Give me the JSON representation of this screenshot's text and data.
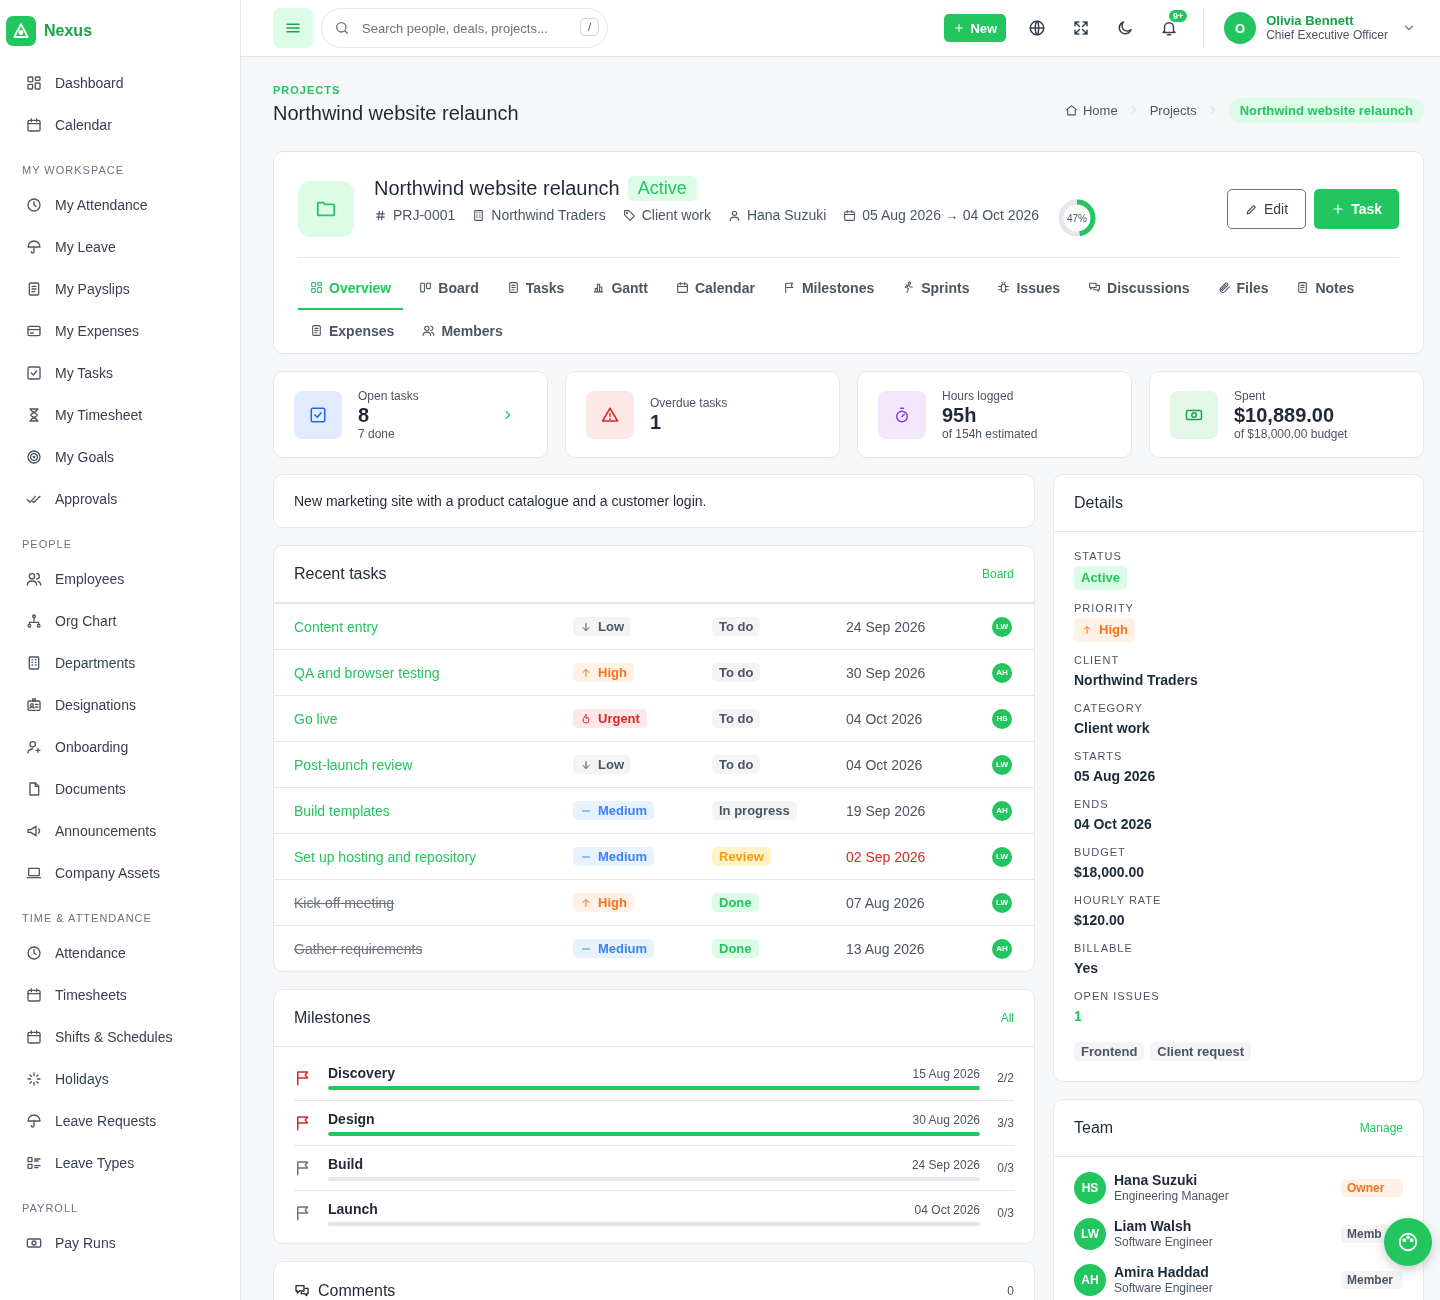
{
  "app": {
    "name": "Nexus"
  },
  "sidebar": {
    "groups": [
      {
        "items": [
          "Dashboard",
          "Calendar"
        ]
      },
      {
        "title": "MY WORKSPACE",
        "items": [
          "My Attendance",
          "My Leave",
          "My Payslips",
          "My Expenses",
          "My Tasks",
          "My Timesheet",
          "My Goals",
          "Approvals"
        ]
      },
      {
        "title": "PEOPLE",
        "items": [
          "Employees",
          "Org Chart",
          "Departments",
          "Designations",
          "Onboarding",
          "Documents",
          "Announcements",
          "Company Assets"
        ]
      },
      {
        "title": "TIME & ATTENDANCE",
        "items": [
          "Attendance",
          "Timesheets",
          "Shifts & Schedules",
          "Holidays",
          "Leave Requests",
          "Leave Types"
        ]
      },
      {
        "title": "PAYROLL",
        "items": [
          "Pay Runs"
        ]
      }
    ]
  },
  "topbar": {
    "search": {
      "placeholder": "Search people, deals, projects...",
      "shortcut": "/"
    },
    "new_button": "New",
    "notification_count": "9+",
    "user": {
      "initial": "O",
      "name": "Olivia Bennett",
      "role": "Chief Executive Officer"
    }
  },
  "page": {
    "section": "PROJECTS",
    "title": "Northwind website relaunch",
    "breadcrumbs": [
      {
        "label": "Home",
        "selected": false
      },
      {
        "label": "Projects",
        "selected": false
      },
      {
        "label": "Northwind website relaunch",
        "selected": true
      }
    ]
  },
  "project": {
    "title": "Northwind website relaunch",
    "status": "Active",
    "meta": [
      {
        "kind": "id",
        "text": "PRJ-0001"
      },
      {
        "kind": "client",
        "text": "Northwind Traders"
      },
      {
        "kind": "category",
        "text": "Client work"
      },
      {
        "kind": "owner",
        "text": "Hana Suzuki"
      },
      {
        "kind": "dates",
        "text": "05 Aug 2026 → 04 Oct 2026"
      }
    ],
    "progress": {
      "level": 0.47,
      "label": "47%"
    },
    "edit_button": "Edit",
    "task_button": "Task",
    "tabs": [
      {
        "label": "Overview",
        "selected": true
      },
      {
        "label": "Board",
        "selected": false
      },
      {
        "label": "Tasks",
        "selected": false
      },
      {
        "label": "Gantt",
        "selected": false
      },
      {
        "label": "Calendar",
        "selected": false
      },
      {
        "label": "Milestones",
        "selected": false
      },
      {
        "label": "Sprints",
        "selected": false
      },
      {
        "label": "Issues",
        "selected": false
      },
      {
        "label": "Discussions",
        "selected": false
      },
      {
        "label": "Files",
        "selected": false
      },
      {
        "label": "Notes",
        "selected": false
      },
      {
        "label": "Expenses",
        "selected": false
      },
      {
        "label": "Members",
        "selected": false
      }
    ]
  },
  "stats": [
    {
      "kind": "tasks",
      "label": "Open tasks",
      "value": "8",
      "sub": "7 done",
      "arrow": true
    },
    {
      "kind": "overdue",
      "label": "Overdue tasks",
      "value": "1",
      "arrow": false
    },
    {
      "kind": "hours",
      "label": "Hours logged",
      "value": "95h",
      "sub": "of 154h estimated",
      "arrow": false
    },
    {
      "kind": "spent",
      "label": "Spent",
      "value": "$10,889.00",
      "sub": "of $18,000.00 budget",
      "arrow": false
    }
  ],
  "description": "New marketing site with a product catalogue and a customer login.",
  "recent_tasks": {
    "title": "Recent tasks",
    "link": "Board",
    "rows": [
      {
        "name": "Content entry",
        "done": false,
        "priority": {
          "kind": "low",
          "label": "Low"
        },
        "status": {
          "kind": "todo",
          "label": "To do"
        },
        "due": "24 Sep 2026",
        "overdue": false,
        "assignee": "LW"
      },
      {
        "name": "QA and browser testing",
        "done": false,
        "priority": {
          "kind": "high",
          "label": "High"
        },
        "status": {
          "kind": "todo",
          "label": "To do"
        },
        "due": "30 Sep 2026",
        "overdue": false,
        "assignee": "AH"
      },
      {
        "name": "Go live",
        "done": false,
        "priority": {
          "kind": "urgent",
          "label": "Urgent"
        },
        "status": {
          "kind": "todo",
          "label": "To do"
        },
        "due": "04 Oct 2026",
        "overdue": false,
        "assignee": "HS"
      },
      {
        "name": "Post-launch review",
        "done": false,
        "priority": {
          "kind": "low",
          "label": "Low"
        },
        "status": {
          "kind": "todo",
          "label": "To do"
        },
        "due": "04 Oct 2026",
        "overdue": false,
        "assignee": "LW"
      },
      {
        "name": "Build templates",
        "done": false,
        "priority": {
          "kind": "medium",
          "label": "Medium"
        },
        "status": {
          "kind": "progress",
          "label": "In progress"
        },
        "due": "19 Sep 2026",
        "overdue": false,
        "assignee": "AH"
      },
      {
        "name": "Set up hosting and repository",
        "done": false,
        "priority": {
          "kind": "medium",
          "label": "Medium"
        },
        "status": {
          "kind": "review",
          "label": "Review"
        },
        "due": "02 Sep 2026",
        "overdue": true,
        "assignee": "LW"
      },
      {
        "name": "Kick-off meeting",
        "done": true,
        "priority": {
          "kind": "high",
          "label": "High"
        },
        "status": {
          "kind": "done",
          "label": "Done"
        },
        "due": "07 Aug 2026",
        "overdue": false,
        "assignee": "LW"
      },
      {
        "name": "Gather requirements",
        "done": true,
        "priority": {
          "kind": "medium",
          "label": "Medium"
        },
        "status": {
          "kind": "done",
          "label": "Done"
        },
        "due": "13 Aug 2026",
        "overdue": false,
        "assignee": "AH"
      }
    ]
  },
  "milestones": {
    "title": "Milestones",
    "link": "All",
    "items": [
      {
        "name": "Discovery",
        "date": "15 Aug 2026",
        "count": "2/2",
        "level": 1,
        "completed": true
      },
      {
        "name": "Design",
        "date": "30 Aug 2026",
        "count": "3/3",
        "level": 1,
        "completed": true
      },
      {
        "name": "Build",
        "date": "24 Sep 2026",
        "count": "0/3",
        "level": 0,
        "completed": false
      },
      {
        "name": "Launch",
        "date": "04 Oct 2026",
        "count": "0/3",
        "level": 0,
        "completed": false
      }
    ]
  },
  "comments": {
    "title": "Comments",
    "count": "0"
  },
  "details": {
    "title": "Details",
    "fields": [
      {
        "kind": "status",
        "label": "STATUS",
        "value": "Active"
      },
      {
        "kind": "priority",
        "label": "PRIORITY",
        "value": "High"
      },
      {
        "kind": "text",
        "label": "CLIENT",
        "value": "Northwind Traders"
      },
      {
        "kind": "text",
        "label": "CATEGORY",
        "value": "Client work"
      },
      {
        "kind": "text",
        "label": "STARTS",
        "value": "05 Aug 2026"
      },
      {
        "kind": "text",
        "label": "ENDS",
        "value": "04 Oct 2026"
      },
      {
        "kind": "text",
        "label": "BUDGET",
        "value": "$18,000.00"
      },
      {
        "kind": "text",
        "label": "HOURLY RATE",
        "value": "$120.00"
      },
      {
        "kind": "text",
        "label": "BILLABLE",
        "value": "Yes"
      },
      {
        "kind": "link",
        "label": "OPEN ISSUES",
        "value": "1"
      }
    ],
    "tags": [
      "Frontend",
      "Client request"
    ]
  },
  "team": {
    "title": "Team",
    "link": "Manage",
    "members": [
      {
        "initials": "HS",
        "name": "Hana Suzuki",
        "role": "Engineering Manager",
        "badge": {
          "kind": "owner",
          "label": "Owner"
        }
      },
      {
        "initials": "LW",
        "name": "Liam Walsh",
        "role": "Software Engineer",
        "badge": {
          "kind": "member",
          "label": "Memb"
        }
      },
      {
        "initials": "AH",
        "name": "Amira Haddad",
        "role": "Software Engineer",
        "badge": {
          "kind": "member",
          "label": "Member"
        }
      }
    ]
  }
}
